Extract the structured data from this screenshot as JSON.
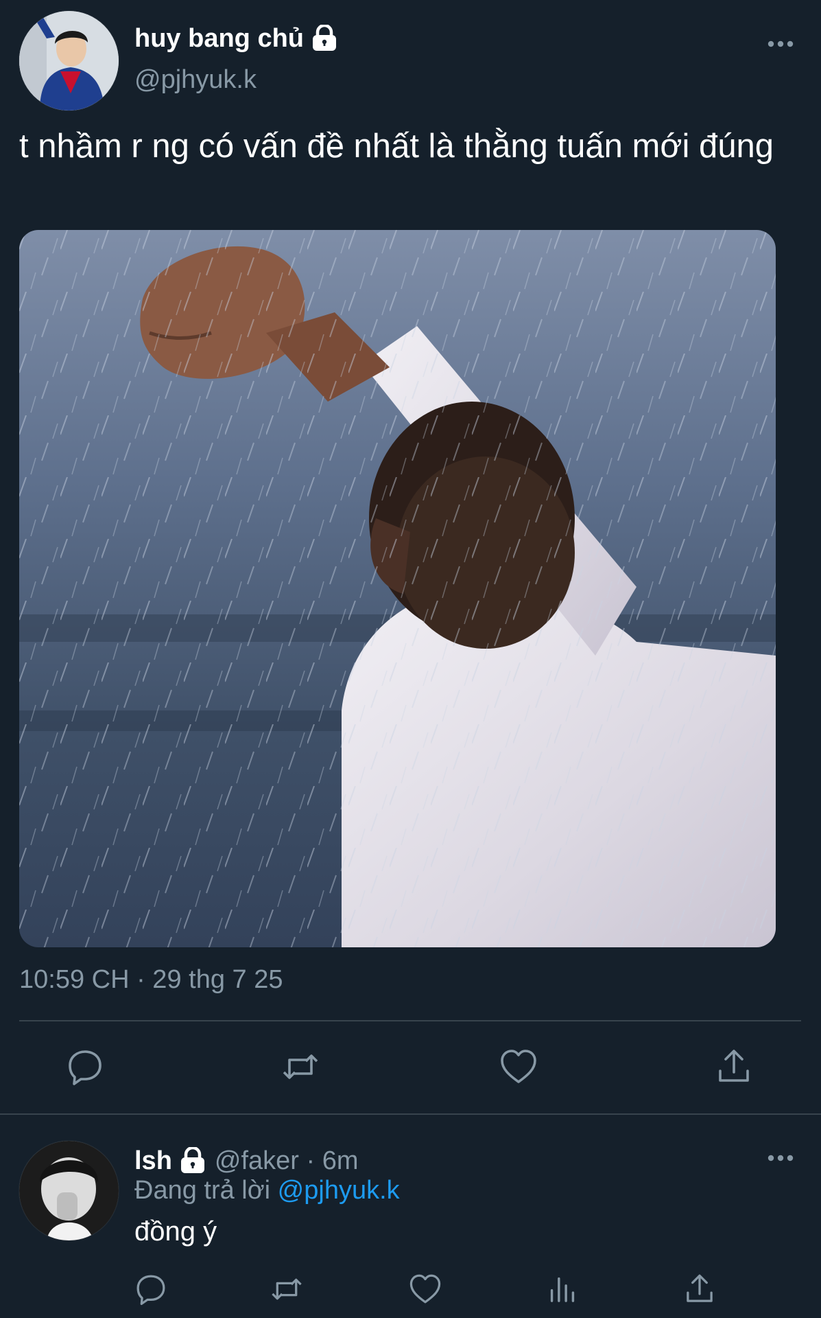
{
  "main_tweet": {
    "author": {
      "display_name": "huy bang chủ",
      "handle": "@pjhyuk.k",
      "protected": true
    },
    "text": "t nhầm r ng có vấn đề nhất là thằng tuấn mới đúng",
    "timestamp": "10:59 CH · 29 thg 7 25",
    "actions": [
      "reply-icon",
      "retweet-icon",
      "like-icon",
      "share-icon"
    ]
  },
  "reply_tweet": {
    "author": {
      "display_name": "lsh",
      "handle_and_time": "@faker · 6m",
      "protected": true
    },
    "replying_prefix": "Đang trả lời",
    "replying_to": "@pjhyuk.k",
    "text": "đồng ý",
    "actions": [
      "reply-icon",
      "retweet-icon",
      "like-icon",
      "stats-icon",
      "share-icon"
    ]
  },
  "colors": {
    "background": "#15202b",
    "text_primary": "#ffffff",
    "text_secondary": "#8899a6",
    "link": "#1d9bf0",
    "divider": "#38444d"
  }
}
